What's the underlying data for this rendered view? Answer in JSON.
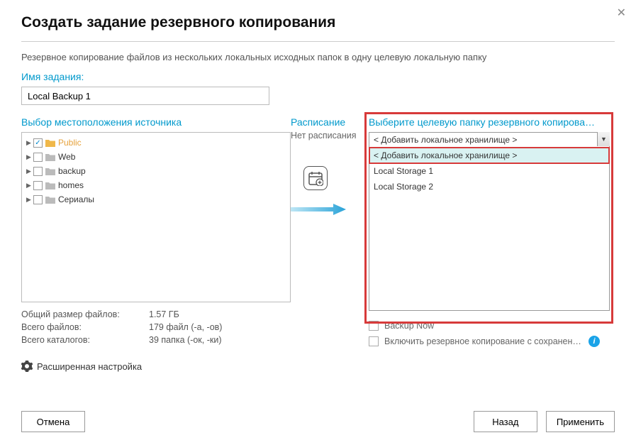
{
  "title": "Создать задание резервного копирования",
  "description": "Резервное копирование файлов из нескольких локальных исходных папок в одну целевую локальную папку",
  "task_name": {
    "label": "Имя задания:",
    "value": "Local Backup 1"
  },
  "source": {
    "label": "Выбор местоположения источника",
    "items": [
      {
        "name": "Public",
        "checked": true,
        "selected": true
      },
      {
        "name": "Web",
        "checked": false,
        "selected": false
      },
      {
        "name": "backup",
        "checked": false,
        "selected": false
      },
      {
        "name": "homes",
        "checked": false,
        "selected": false
      },
      {
        "name": "Сериалы",
        "checked": false,
        "selected": false
      }
    ],
    "stats": {
      "total_size_k": "Общий размер файлов:",
      "total_size_v": "1.57 ГБ",
      "files_k": "Всего файлов:",
      "files_v": "179 файл (-а, -ов)",
      "folders_k": "Всего каталогов:",
      "folders_v": "39 папка (-ок, -ки)"
    }
  },
  "advanced_label": "Расширенная настройка",
  "schedule": {
    "label": "Расписание",
    "none": "Нет расписания"
  },
  "destination": {
    "label": "Выберите целевую папку резервного копирова…",
    "selected": "< Добавить локальное хранилище >",
    "options": [
      "< Добавить локальное хранилище >",
      "Local Storage 1",
      "Local Storage 2"
    ],
    "backup_now": "Backup Now",
    "versioning": "Включить резервное копирование с сохранением не…"
  },
  "buttons": {
    "cancel": "Отмена",
    "back": "Назад",
    "apply": "Применить"
  }
}
